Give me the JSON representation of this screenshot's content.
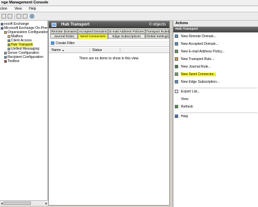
{
  "window": {
    "title": "nge Management Console"
  },
  "menubar": [
    "ction",
    "View",
    "Help"
  ],
  "tree": {
    "items": [
      {
        "label": "rosoft Exchange",
        "indent": 0,
        "icon": "exchange-icon",
        "color": "#3b6fb6"
      },
      {
        "label": "Microsoft Exchange On-Premises (",
        "indent": 0,
        "icon": "exchange-icon",
        "color": "#3b6fb6"
      },
      {
        "label": "Organization Configuration",
        "indent": 5,
        "icon": "org-icon",
        "color": "#d9a030"
      },
      {
        "label": "Mailbox",
        "indent": 10,
        "icon": "mailbox-icon",
        "color": "#e0c050"
      },
      {
        "label": "Client Access",
        "indent": 10,
        "icon": "client-access-icon",
        "color": "#4f8fd0"
      },
      {
        "label": "Hub Transport",
        "indent": 10,
        "icon": "hub-transport-icon",
        "color": "#6aa84f",
        "highlight": true
      },
      {
        "label": "Unified Messaging",
        "indent": 10,
        "icon": "unified-messaging-icon",
        "color": "#7ab0e0"
      },
      {
        "label": "Server Configuration",
        "indent": 5,
        "icon": "server-icon",
        "color": "#8f8f8f"
      },
      {
        "label": "Recipient Configuration",
        "indent": 5,
        "icon": "recipient-icon",
        "color": "#5a8fd0"
      },
      {
        "label": "Toolbox",
        "indent": 5,
        "icon": "toolbox-icon",
        "color": "#c0392b"
      }
    ]
  },
  "middle": {
    "title": "Hub Transport",
    "count": "0 objects",
    "tabs_row1": [
      "Remote Domains",
      "Accepted Domains",
      "E-mail Address Policies",
      "Transport Rules"
    ],
    "tabs_row2": [
      "Journal Rules",
      "Send Connectors",
      "Edge Subscriptions",
      "Global Settings"
    ],
    "active_tab": "Send Connectors",
    "filter_label": "Create Filter",
    "columns": [
      "Name",
      "Status"
    ],
    "empty_message": "There are no items to show in this view."
  },
  "actions": {
    "title": "Actions",
    "section": "Hub Transport",
    "items": [
      {
        "label": "New Remote Domain...",
        "icon": "remote-domain-icon",
        "color": "#4f8fd0"
      },
      {
        "label": "New Accepted Domain...",
        "icon": "accepted-domain-icon",
        "color": "#4f8fd0"
      },
      {
        "label": "New E-mail Address Policy...",
        "icon": "email-policy-icon",
        "color": "#5a9e4f"
      },
      {
        "label": "New Transport Rule...",
        "icon": "transport-rule-icon",
        "color": "#d9a030"
      },
      {
        "label": "New Journal Rule...",
        "icon": "journal-rule-icon",
        "color": "#3d7a3d"
      },
      {
        "label": "New Send Connector...",
        "icon": "send-connector-icon",
        "color": "#6aa84f",
        "highlight": true
      },
      {
        "label": "New Edge Subscription...",
        "icon": "edge-subscription-icon",
        "color": "#4f8fd0"
      },
      {
        "label": "Export List...",
        "icon": "export-icon",
        "color": "#ffffff",
        "sep_before": true
      },
      {
        "label": "View",
        "icon": "",
        "color": "#ffffff"
      },
      {
        "label": "Refresh",
        "icon": "refresh-icon",
        "color": "#3a9a3a"
      },
      {
        "label": "Help",
        "icon": "help-icon",
        "color": "#3c6fc4",
        "sep_before": true
      }
    ]
  }
}
